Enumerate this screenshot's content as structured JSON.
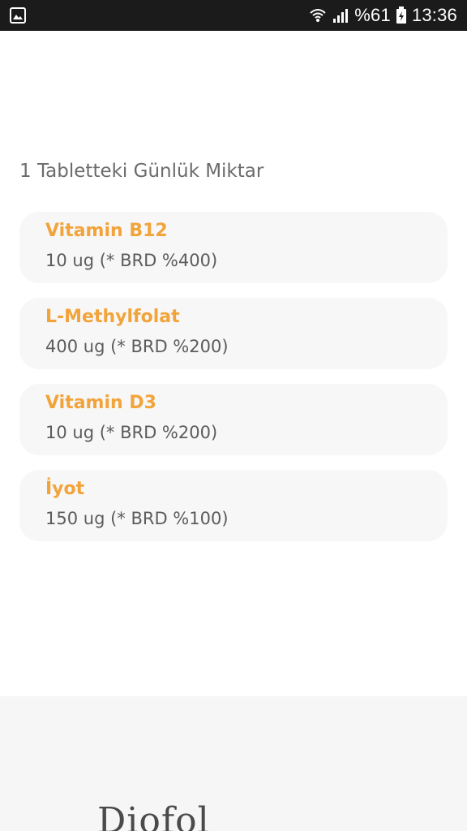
{
  "status_bar": {
    "left_icon": "gallery-notification-icon",
    "wifi_icon": "wifi-icon",
    "signal_icon": "signal-icon",
    "battery_text": "%61",
    "battery_icon": "battery-charging-icon",
    "time": "13:36"
  },
  "content": {
    "section_title": "1 Tabletteki Günlük Miktar",
    "items": [
      {
        "name": "Vitamin B12",
        "amount": "10 ug (* BRD %400)"
      },
      {
        "name": "L-Methylfolat",
        "amount": "400 ug (* BRD %200)"
      },
      {
        "name": "Vitamin D3",
        "amount": "10 ug (* BRD %200)"
      },
      {
        "name": "İyot",
        "amount": "150 ug (* BRD %100)"
      }
    ]
  },
  "footer": {
    "logo_text": "Diofol"
  },
  "colors": {
    "accent": "#f2a33a",
    "status_bar_bg": "#1b1b1b",
    "card_bg": "#f7f7f7",
    "footer_bg": "#f6f6f6"
  }
}
